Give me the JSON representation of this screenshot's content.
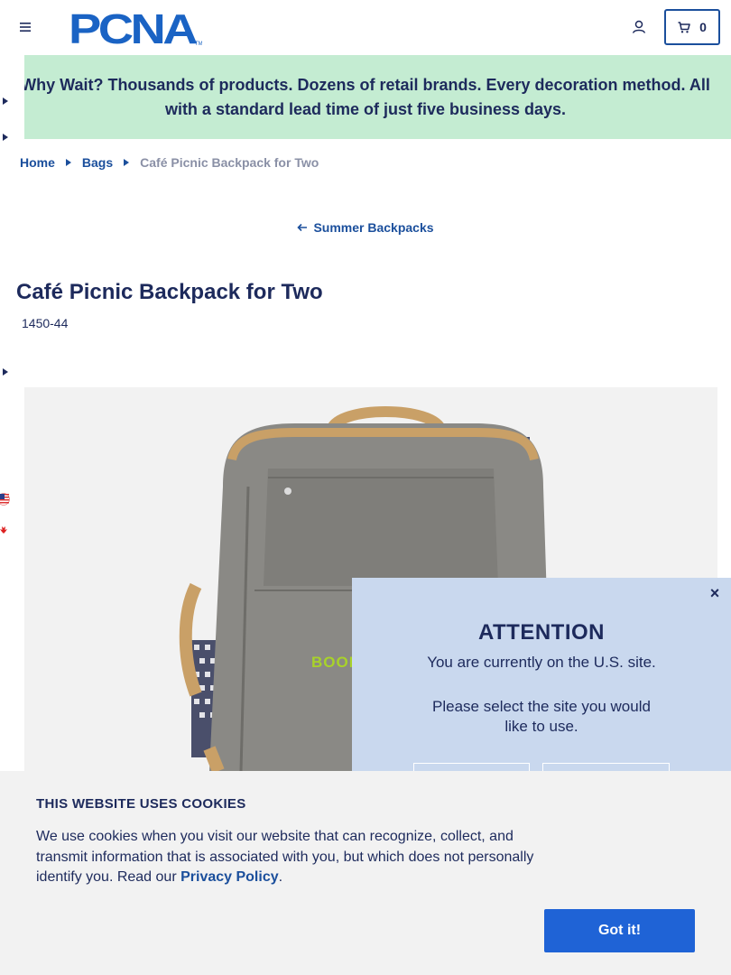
{
  "header": {
    "logo_text": "PCNA",
    "cart_count": "0"
  },
  "banner": {
    "text": "Why Wait? Thousands of products. Dozens of retail brands. Every decoration method. All with a standard lead time of just five business days."
  },
  "breadcrumb": {
    "items": [
      "Home",
      "Bags"
    ],
    "current": "Café Picnic Backpack for Two"
  },
  "back_link": "Summer Backpacks",
  "product": {
    "title": "Café Picnic Backpack for Two",
    "sku": "1450-44",
    "image_imprint": "BOOM"
  },
  "modal": {
    "close": "×",
    "title": "ATTENTION",
    "line1": "You are currently on the U.S. site.",
    "line2": "Please select the site you would like to use."
  },
  "cookie": {
    "title": "THIS WEBSITE USES COOKIES",
    "body_prefix": "We use cookies when you visit our website that can recognize, collect, and transmit information that is associated with you, but which does not personally identify you. Read our ",
    "link": "Privacy Policy",
    "body_suffix": ".",
    "button": "Got it!"
  },
  "colors": {
    "navy": "#1d2a5c",
    "link_blue": "#1b4f9c",
    "banner_green": "#c4ecd2",
    "modal_blue": "#c9d8ee",
    "cookie_button": "#1f63d6"
  },
  "icons": [
    "hamburger-menu-icon",
    "account-icon",
    "cart-icon",
    "caret-right-icon",
    "arrow-left-icon",
    "us-flag-icon",
    "canada-flag-icon",
    "close-icon"
  ]
}
